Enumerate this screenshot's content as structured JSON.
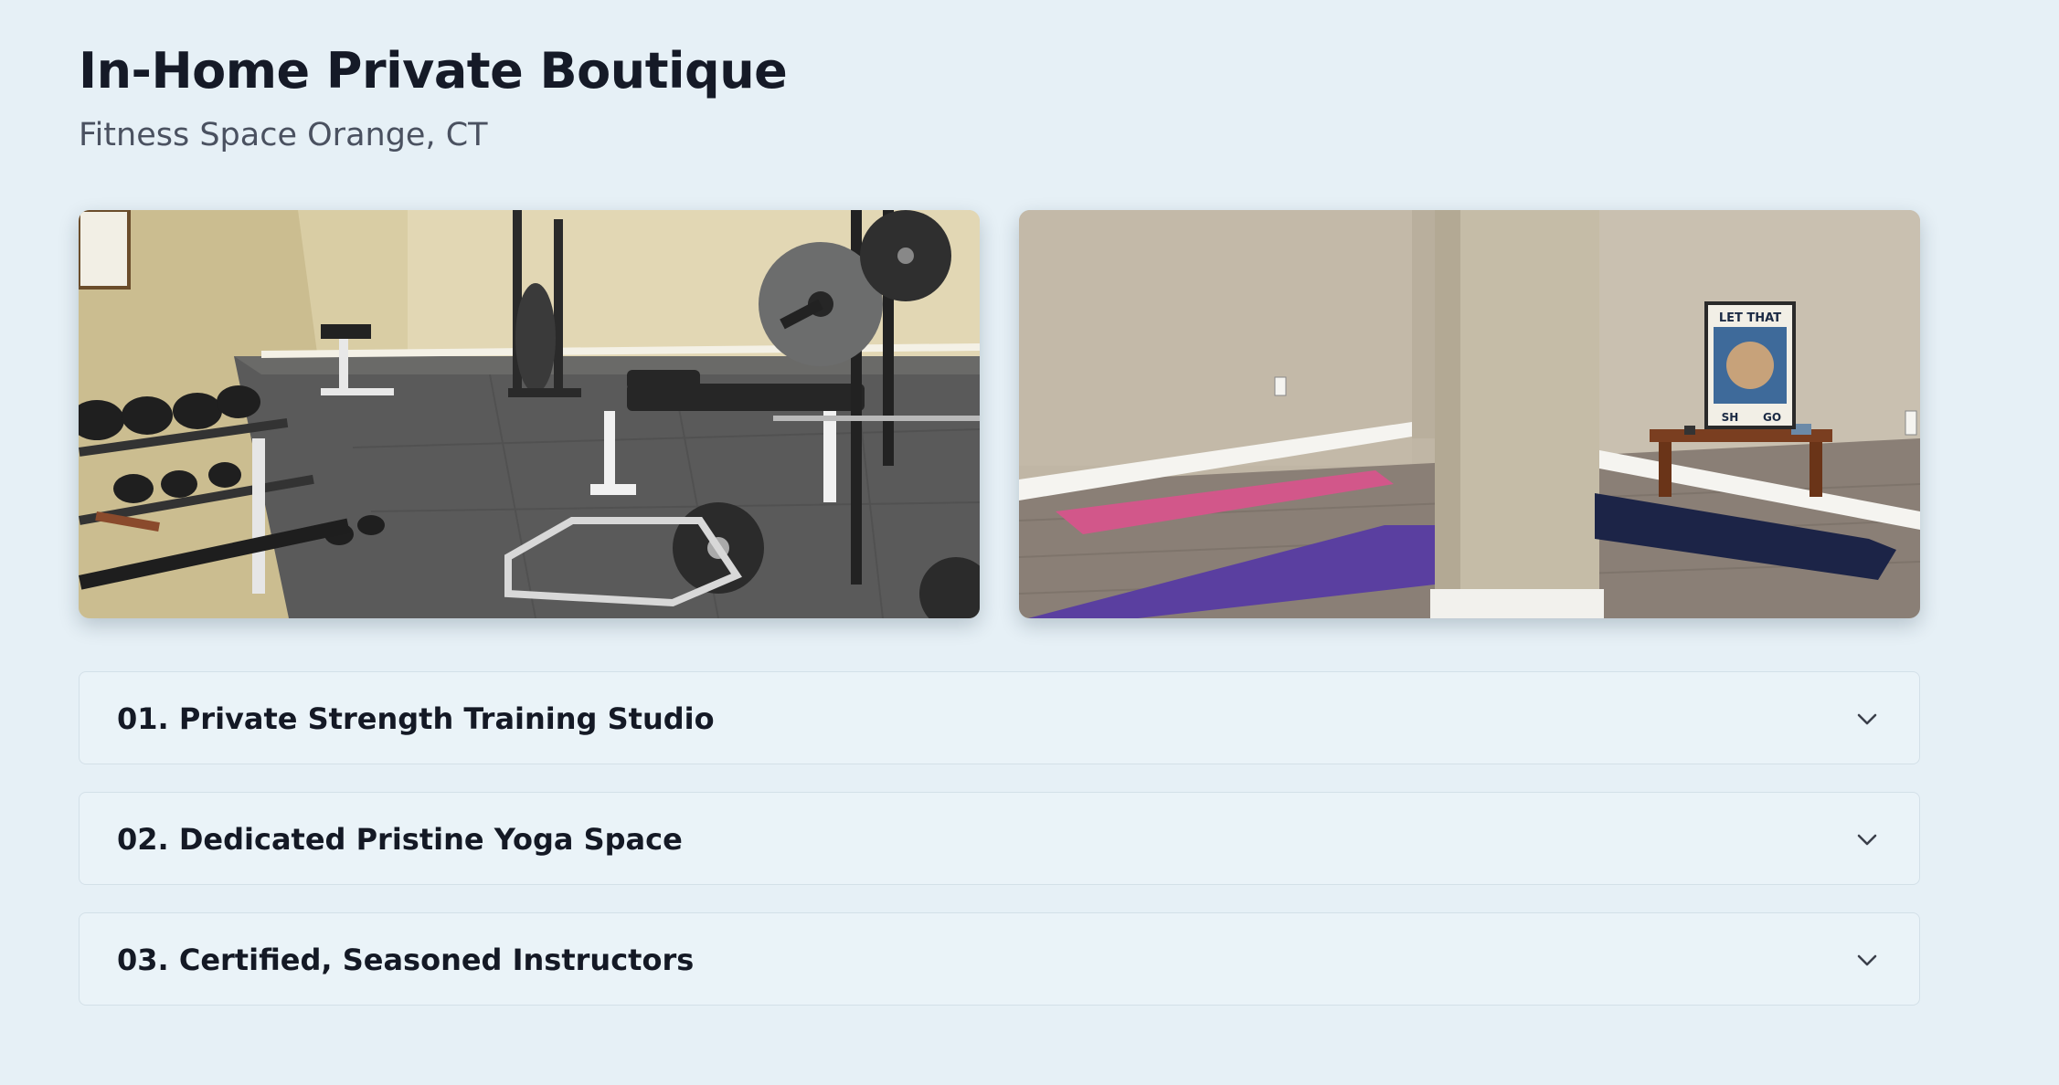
{
  "header": {
    "title": "In-Home Private Boutique",
    "subtitle": "Fitness Space Orange, CT"
  },
  "gallery": {
    "images": [
      {
        "name": "strength-gym-photo",
        "subject": "home gym with dumbbell rack, weight bench, barbell plates and trap bar on rubber floor mats"
      },
      {
        "name": "yoga-room-photo",
        "subject": "yoga room with pink and purple mats, a support column and a bench with a framed poster"
      }
    ],
    "poster_text": [
      "LET THAT",
      "SH",
      "GO"
    ]
  },
  "accordion": {
    "items": [
      {
        "label": "01. Private Strength Training Studio",
        "icon": "chevron-down-icon"
      },
      {
        "label": "02. Dedicated Pristine Yoga Space",
        "icon": "chevron-down-icon"
      },
      {
        "label": "03. Certified, Seasoned Instructors",
        "icon": "chevron-down-icon"
      }
    ]
  },
  "colors": {
    "background": "#e6f0f6",
    "heading": "#151a27",
    "subheading": "#4a5160",
    "card_border": "#d3e0e8"
  }
}
